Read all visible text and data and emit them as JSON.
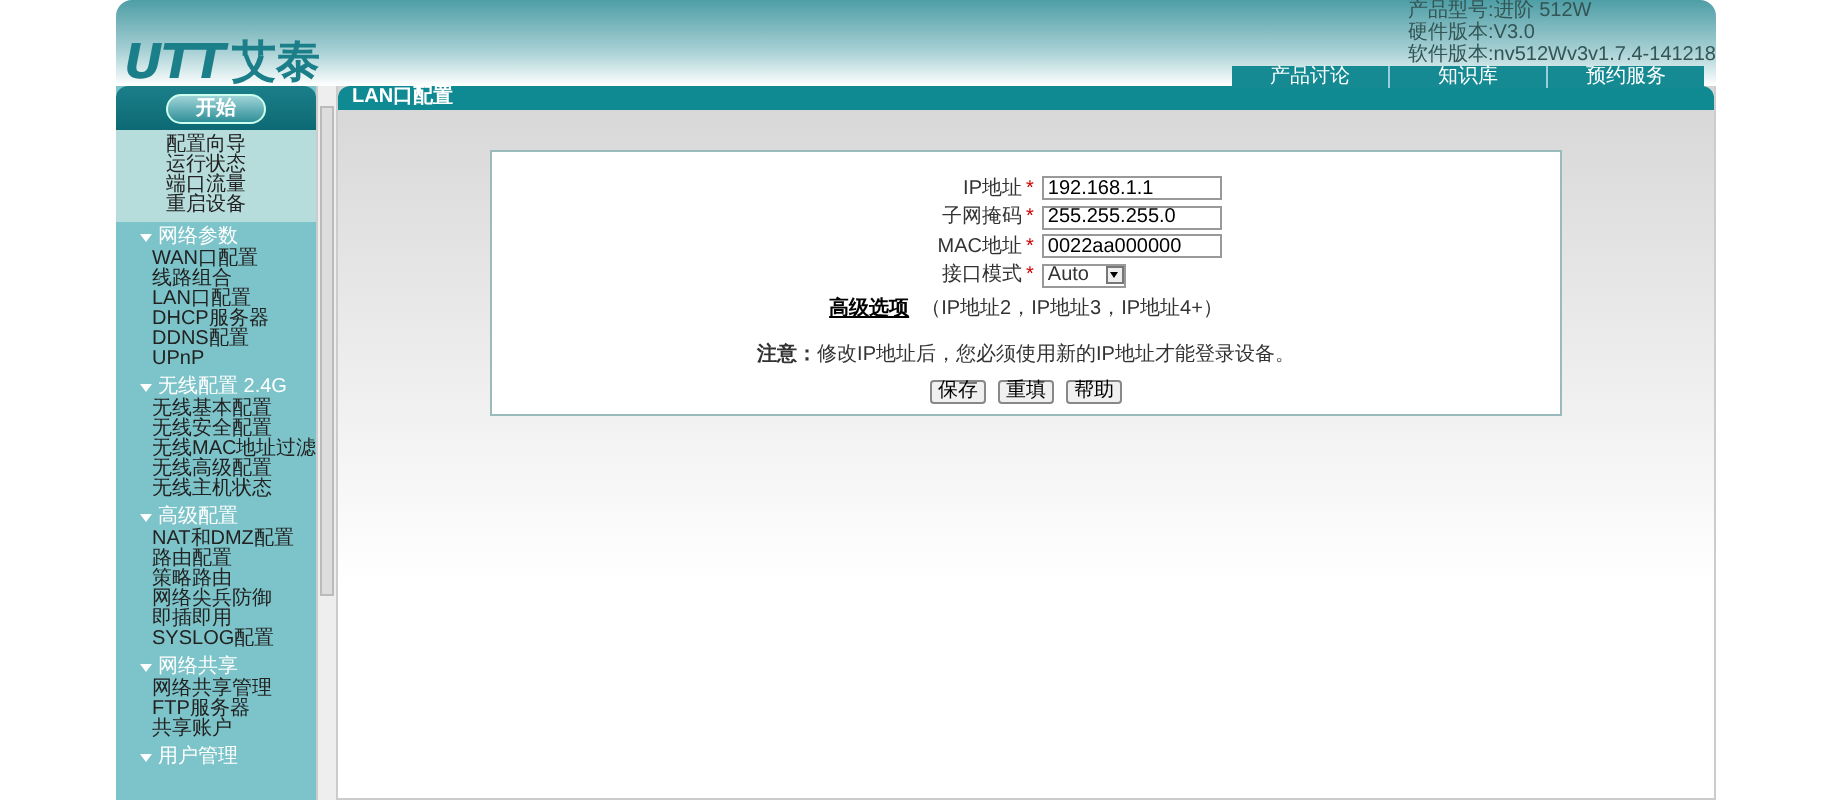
{
  "header": {
    "logo_mark": "UTT",
    "logo_text": "艾泰",
    "info": [
      "产品型号:进阶 512W",
      "硬件版本:V3.0",
      "软件版本:nv512Wv3v1.7.4-141218"
    ],
    "nav": [
      "产品讨论",
      "知识库",
      "预约服务"
    ]
  },
  "sidebar": {
    "start": "开始",
    "quick": [
      "配置向导",
      "运行状态",
      "端口流量",
      "重启设备"
    ],
    "groups": [
      {
        "title": "网络参数",
        "expanded": true,
        "items": [
          "WAN口配置",
          "线路组合",
          "LAN口配置",
          "DHCP服务器",
          "DDNS配置",
          "UPnP"
        ]
      },
      {
        "title": "无线配置 2.4G",
        "expanded": true,
        "items": [
          "无线基本配置",
          "无线安全配置",
          "无线MAC地址过滤",
          "无线高级配置",
          "无线主机状态"
        ]
      },
      {
        "title": "高级配置",
        "expanded": true,
        "items": [
          "NAT和DMZ配置",
          "路由配置",
          "策略路由",
          "网络尖兵防御",
          "即插即用",
          "SYSLOG配置"
        ]
      },
      {
        "title": "网络共享",
        "expanded": true,
        "items": [
          "网络共享管理",
          "FTP服务器",
          "共享账户"
        ]
      },
      {
        "title": "用户管理",
        "expanded": true
      }
    ]
  },
  "main": {
    "title": "LAN口配置",
    "fields": [
      {
        "kind": "input",
        "label": "IP地址",
        "required_mark": "*",
        "value": "192.168.1.1"
      },
      {
        "kind": "input",
        "label": "子网掩码",
        "required_mark": "*",
        "value": "255.255.255.0"
      },
      {
        "kind": "input",
        "label": "MAC地址",
        "required_mark": "*",
        "value": "0022aa000000"
      },
      {
        "kind": "select",
        "label": "接口模式",
        "required_mark": "*",
        "value": "Auto"
      }
    ],
    "advanced": {
      "link": "高级选项",
      "hint": "（IP地址2，IP地址3，IP地址4+）"
    },
    "note": "**注意：**修改IP地址后，您必须使用新的IP地址才能登录设备。",
    "buttons": [
      "保存",
      "重填",
      "帮助"
    ]
  }
}
